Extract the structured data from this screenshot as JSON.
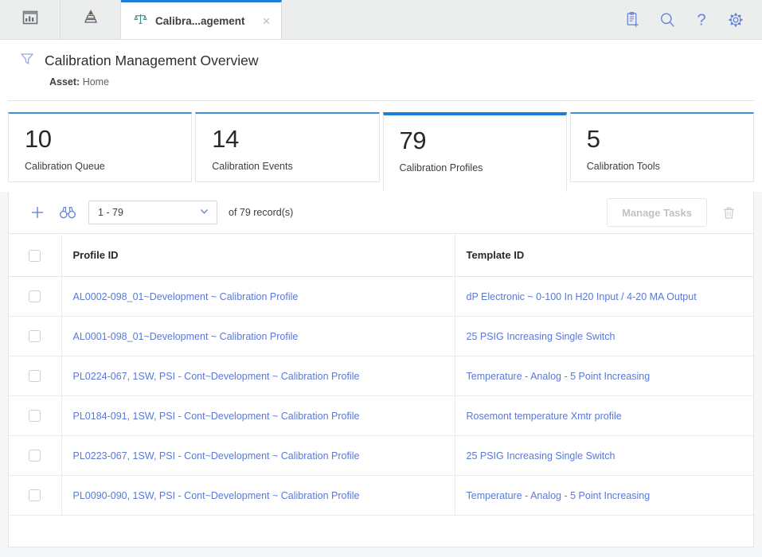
{
  "window": {
    "nav_buttons": [
      {
        "name": "dashboard-icon",
        "label": "Dashboard"
      },
      {
        "name": "hierarchy-icon",
        "label": "Asset Hierarchy"
      }
    ],
    "tab": {
      "icon": "scales-icon",
      "title": "Calibra...agement",
      "close": "×"
    },
    "top_icons": [
      {
        "name": "new-record-icon",
        "label": "New"
      },
      {
        "name": "search-icon",
        "label": "Search"
      },
      {
        "name": "help-icon",
        "label": "Help"
      },
      {
        "name": "settings-gear-icon",
        "label": "Settings"
      }
    ]
  },
  "header": {
    "filter_icon": "filter-funnel-icon",
    "title": "Calibration Management Overview",
    "asset_label": "Asset:",
    "asset_value": "Home"
  },
  "cards": [
    {
      "value": "10",
      "label": "Calibration Queue",
      "selected": false
    },
    {
      "value": "14",
      "label": "Calibration Events",
      "selected": false
    },
    {
      "value": "79",
      "label": "Calibration Profiles",
      "selected": true
    },
    {
      "value": "5",
      "label": "Calibration Tools",
      "selected": false
    }
  ],
  "toolbar": {
    "add_icon": "plus-icon",
    "binoculars_icon": "binoculars-icon",
    "range_select": {
      "value": "1 - 79",
      "chevron": "chevron-down-icon"
    },
    "records_text": "of 79 record(s)",
    "manage_tasks_label": "Manage Tasks",
    "delete_icon": "trash-icon"
  },
  "table": {
    "columns": [
      "",
      "Profile ID",
      "Template ID"
    ],
    "rows": [
      {
        "profile_id": "AL0002-098_01~Development ~ Calibration Profile",
        "template_id": "dP Electronic ~ 0-100 In H20 Input / 4-20 MA Output"
      },
      {
        "profile_id": "AL0001-098_01~Development ~ Calibration Profile",
        "template_id": "25 PSIG Increasing Single Switch"
      },
      {
        "profile_id": "PL0224-067, 1SW, PSI - Cont~Development ~ Calibration Profile",
        "template_id": "Temperature - Analog - 5 Point Increasing"
      },
      {
        "profile_id": "PL0184-091, 1SW, PSI - Cont~Development ~ Calibration Profile",
        "template_id": "Rosemont temperature Xmtr profile"
      },
      {
        "profile_id": "PL0223-067, 1SW, PSI - Cont~Development ~ Calibration Profile",
        "template_id": "25 PSIG Increasing Single Switch"
      },
      {
        "profile_id": "PL0090-090, 1SW, PSI - Cont~Development ~ Calibration Profile",
        "template_id": "Temperature - Analog - 5 Point Increasing"
      }
    ]
  },
  "colors": {
    "accent": "#1c7ed6",
    "link": "#5a79d6",
    "icon": "#6583d8",
    "tab_icon": "#3f8f8a"
  }
}
